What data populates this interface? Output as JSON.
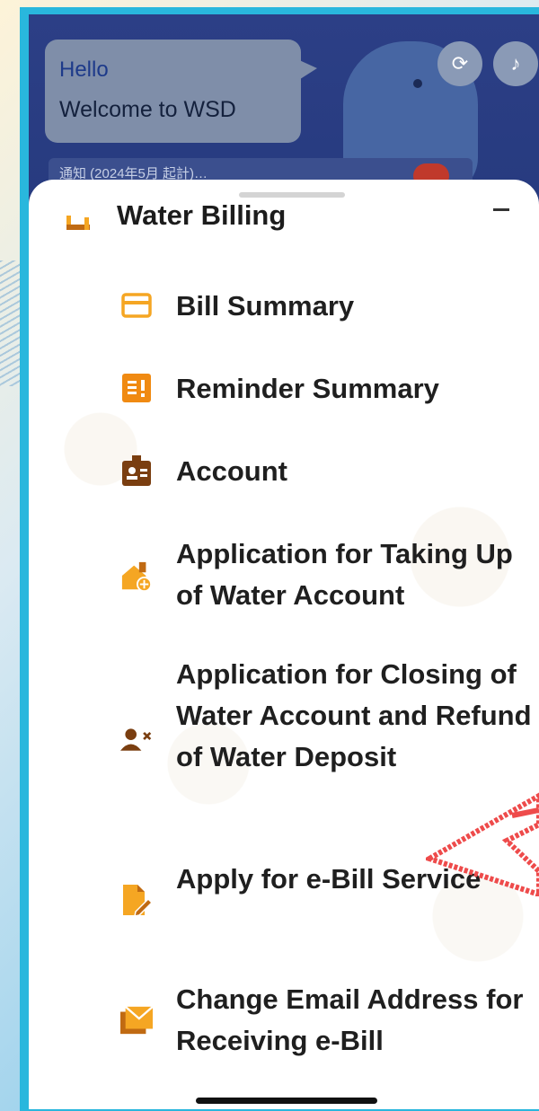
{
  "header": {
    "greeting": "Hello",
    "welcome": "Welcome to WSD",
    "ticker": "通知 (2024年5月 起計)…"
  },
  "section": {
    "title": "Water Billing",
    "collapse_symbol": "–"
  },
  "menu": {
    "items": [
      {
        "label": "Bill Summary",
        "icon": "card-icon"
      },
      {
        "label": "Reminder Summary",
        "icon": "reminder-icon"
      },
      {
        "label": "Account",
        "icon": "account-badge-icon"
      },
      {
        "label": "Application for Taking Up of Water Account",
        "icon": "house-add-icon"
      },
      {
        "label": "Application for Closing of Water Account and Refund of Water Deposit",
        "icon": "person-remove-icon"
      },
      {
        "label": "Apply for e-Bill Service",
        "icon": "document-edit-icon"
      },
      {
        "label": "Change Email Address for Receiving e-Bill",
        "icon": "email-change-icon"
      }
    ]
  },
  "colors": {
    "accent": "#f5a623",
    "accent_dark": "#c06a12",
    "account_icon": "#7a3e10",
    "frame": "#29b7dd",
    "header_bg": "#2c3f86",
    "arrow": "#ee4b4b"
  }
}
